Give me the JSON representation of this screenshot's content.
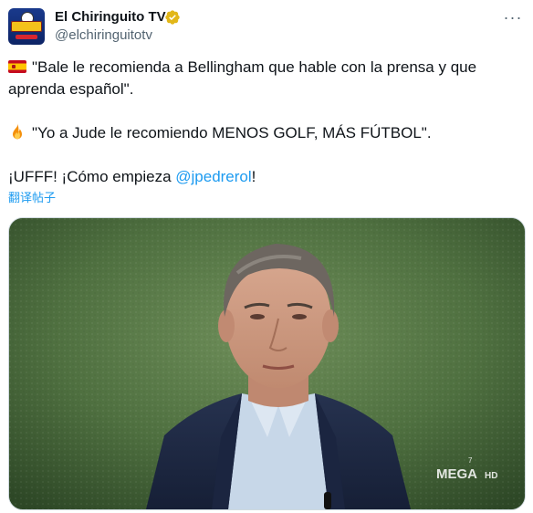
{
  "author": {
    "display_name": "El Chiringuito TV",
    "handle": "@elchiringuitotv",
    "verified_badge_color": "#E2B719",
    "avatar_icon": "el-chiringuito-logo"
  },
  "menu": {
    "more_icon": "more-horizontal-icon",
    "more_glyph": "···"
  },
  "tweet": {
    "line1_emoji": "spain-flag",
    "line1": "\"Bale le recomienda a Bellingham que hable con la prensa y que",
    "line2": "aprenda español\".",
    "line3_emoji": "fire",
    "line3": "\"Yo a Jude le recomiendo MENOS GOLF, MÁS FÚTBOL\".",
    "line4_prefix": "¡UFFF! ¡Cómo empieza ",
    "line4_mention": "@jpedrerol",
    "line4_suffix": "!",
    "translate_label": "翻译帖子"
  },
  "media": {
    "watermark": "MEGA",
    "watermark_hd": "HD",
    "watermark_superscript": "7"
  },
  "colors": {
    "text": "#0f1419",
    "secondary": "#536471",
    "link": "#1d9bf0"
  }
}
